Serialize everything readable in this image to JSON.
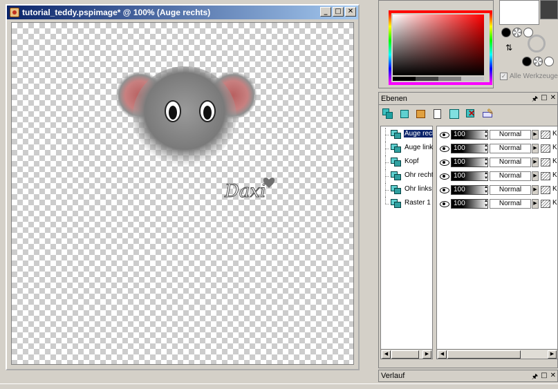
{
  "image_window": {
    "title": "tutorial_teddy.pspimage* @ 100% (Auge rechts)",
    "buttons": {
      "minimize": "_",
      "maximize": "□",
      "close": "✕"
    },
    "signature": "Daxi"
  },
  "color_panel": {
    "all_tools_label": "Alle Werkzeuge",
    "all_tools_checked": true
  },
  "layers_panel": {
    "title": "Ebenen",
    "head_buttons": [
      "🖈",
      "□",
      "✕"
    ],
    "layers": [
      {
        "name": "Auge rechts",
        "opacity": "100",
        "blend": "Normal",
        "selected": true
      },
      {
        "name": "Auge links",
        "opacity": "100",
        "blend": "Normal",
        "selected": false
      },
      {
        "name": "Kopf",
        "opacity": "100",
        "blend": "Normal",
        "selected": false
      },
      {
        "name": "Ohr rechts",
        "opacity": "100",
        "blend": "Normal",
        "selected": false
      },
      {
        "name": "Ohr links",
        "opacity": "100",
        "blend": "Normal",
        "selected": false
      },
      {
        "name": "Raster 1",
        "opacity": "100",
        "blend": "Normal",
        "selected": false
      }
    ],
    "extra_col": "K"
  },
  "history_panel": {
    "title": "Verlauf",
    "head_buttons": [
      "🖈",
      "□",
      "✕"
    ]
  },
  "colors": {
    "titlebar_start": "#0a246a",
    "titlebar_end": "#a6caf0",
    "selection": "#0a246a",
    "ear_pink": "#c07070"
  }
}
